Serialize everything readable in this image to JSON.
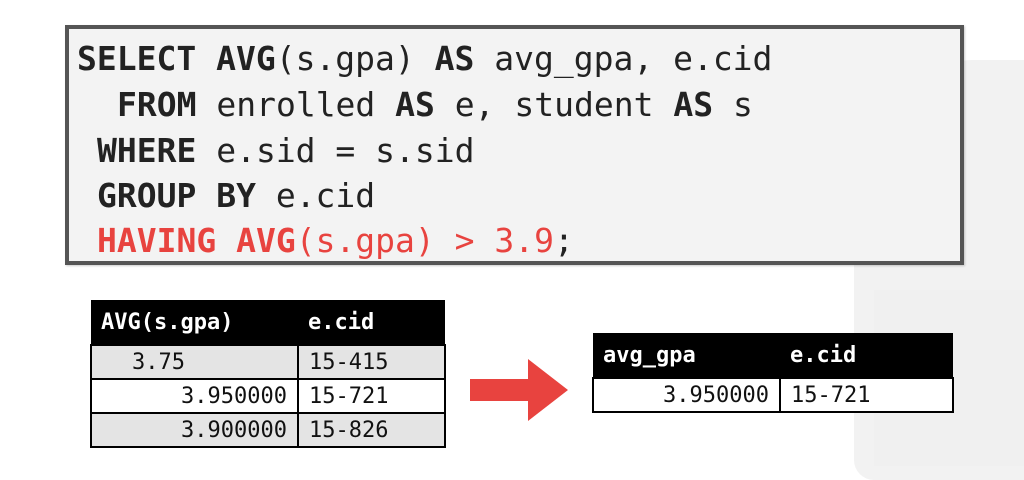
{
  "sql": {
    "line1": {
      "kw": "SELECT",
      "fn": "AVG",
      "arg": "(s.gpa) ",
      "as": "AS",
      "rest": " avg_gpa, e.cid"
    },
    "line2": {
      "kw": "FROM",
      "t1": " enrolled ",
      "as1": "AS",
      "t2": " e, student ",
      "as2": "AS",
      "t3": " s"
    },
    "line3": {
      "kw": "WHERE",
      "rest": " e.sid = s.sid"
    },
    "line4": {
      "kw": "GROUP BY",
      "rest": " e.cid"
    },
    "line5": {
      "kw": "HAVING",
      "fn": " AVG",
      "rest": "(s.gpa) > 3.9",
      "end": ";"
    }
  },
  "left_table": {
    "headers": [
      "AVG(s.gpa)",
      "e.cid"
    ],
    "rows": [
      [
        "3.75",
        "15-415"
      ],
      [
        "3.950000",
        "15-721"
      ],
      [
        "3.900000",
        "15-826"
      ]
    ]
  },
  "right_table": {
    "headers": [
      "avg_gpa",
      "e.cid"
    ],
    "rows": [
      [
        "3.950000",
        "15-721"
      ]
    ]
  },
  "colors": {
    "accent": "#e8433f",
    "header_bg": "#000000",
    "box_bg": "#f3f3f3",
    "box_border": "#555555"
  }
}
